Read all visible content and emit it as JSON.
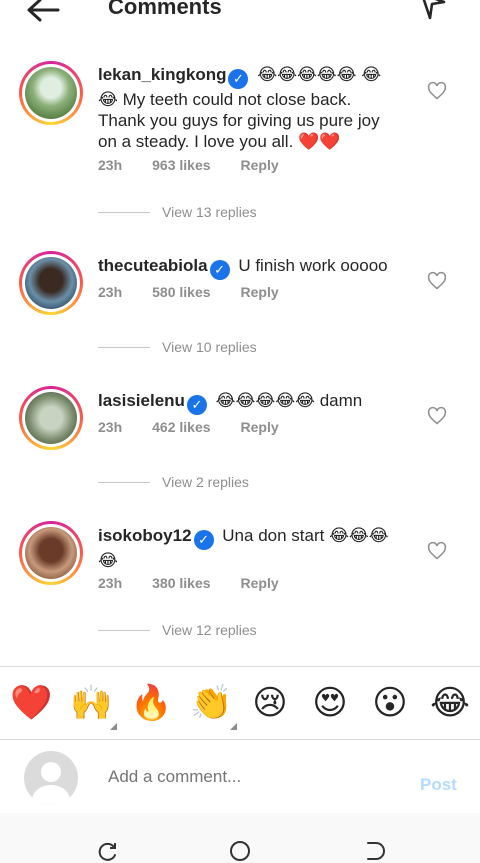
{
  "header": {
    "title": "Comments"
  },
  "comments": [
    {
      "username": "lekan_kingkong",
      "text_line1": "😂😂😂😂😂",
      "text_rest": "😂😂 My teeth could not close back. Thank you guys for giving us pure joy on a steady. I love you all. ❤️❤️",
      "time": "23h",
      "likes": "963 likes",
      "reply": "Reply",
      "view_replies": "View 13 replies"
    },
    {
      "username": "thecuteabiola",
      "text_line1": "U finish work ooooo",
      "text_rest": "",
      "time": "23h",
      "likes": "580 likes",
      "reply": "Reply",
      "view_replies": "View 10 replies"
    },
    {
      "username": "lasisielenu",
      "text_line1": "😂😂😂😂😂 damn",
      "text_rest": "",
      "time": "23h",
      "likes": "462 likes",
      "reply": "Reply",
      "view_replies": "View 2 replies"
    },
    {
      "username": "isokoboy12",
      "text_line1": "Una don start 😂😂😂",
      "text_rest": "😂",
      "time": "23h",
      "likes": "380 likes",
      "reply": "Reply",
      "view_replies": "View 12 replies"
    }
  ],
  "emoji_bar": [
    "❤️",
    "🙌",
    "🔥",
    "👏",
    "😢",
    "😍",
    "😮",
    "😂"
  ],
  "compose": {
    "placeholder": "Add a comment...",
    "post_label": "Post"
  },
  "colors": {
    "accent": "#1a73e8",
    "post_disabled": "#b3dbff",
    "muted": "#8e8e8e"
  }
}
